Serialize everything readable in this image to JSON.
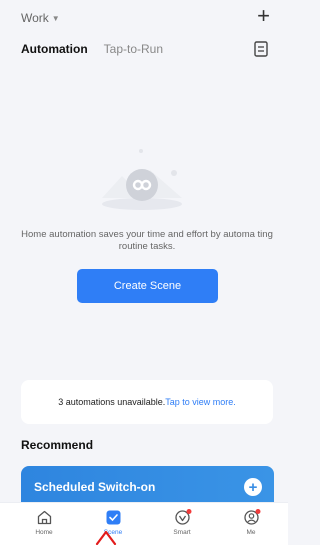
{
  "header": {
    "home_name": "Work",
    "add_icon": "plus-icon"
  },
  "tabs": [
    {
      "label": "Automation",
      "active": true
    },
    {
      "label": "Tap-to-Run",
      "active": false
    }
  ],
  "empty_state": {
    "message": "Home automation saves your time and effort by automa ting routine tasks.",
    "button_label": "Create Scene"
  },
  "unavailable_notice": {
    "text": "3 automations unavailable.",
    "link_text": "Tap to view more."
  },
  "recommend": {
    "title": "Recommend",
    "cards": [
      {
        "title": "Scheduled Switch-on"
      }
    ]
  },
  "bottom_nav": [
    {
      "label": "Home",
      "icon": "home-icon",
      "active": false,
      "badge": false
    },
    {
      "label": "Scene",
      "icon": "scene-icon",
      "active": true,
      "badge": false
    },
    {
      "label": "Smart",
      "icon": "smart-icon",
      "active": false,
      "badge": true
    },
    {
      "label": "Me",
      "icon": "me-icon",
      "active": false,
      "badge": true
    }
  ],
  "colors": {
    "accent": "#2f7ef6",
    "background": "#f4f5f9",
    "badge": "#f23c3c",
    "card_gradient_start": "#2e85df",
    "card_gradient_end": "#3a94e6"
  }
}
